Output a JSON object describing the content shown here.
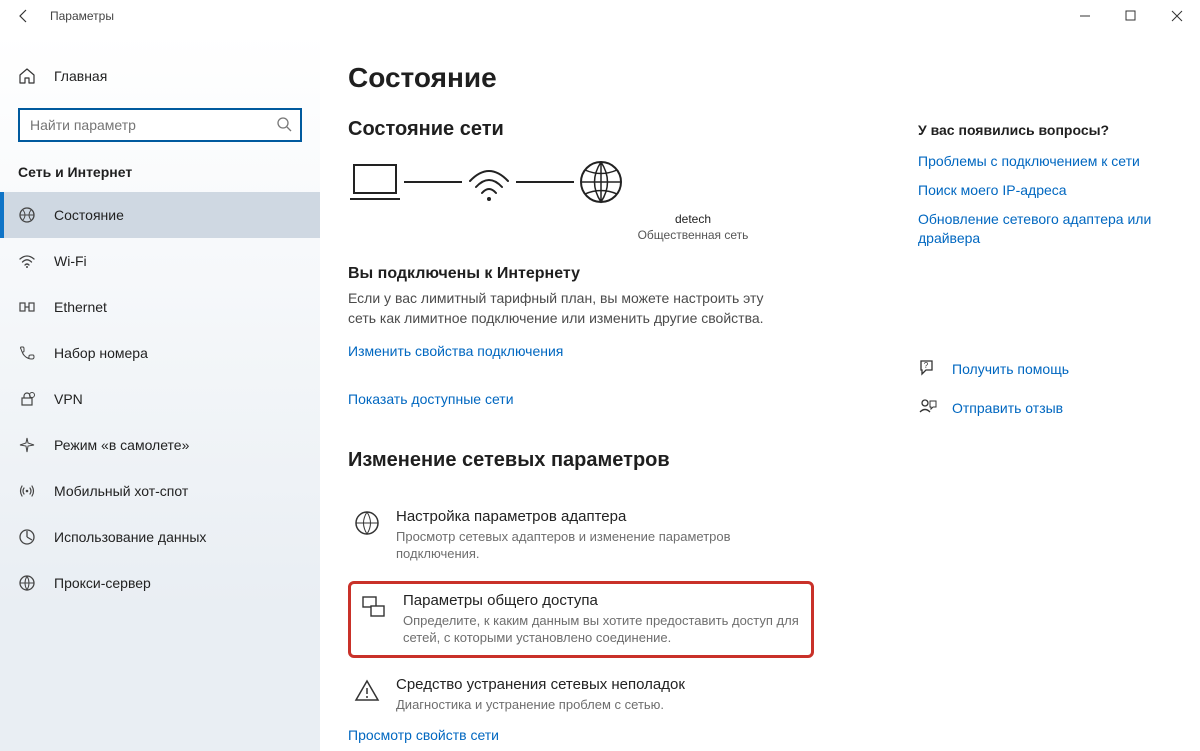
{
  "titlebar": {
    "title": "Параметры"
  },
  "sidebar": {
    "home": "Главная",
    "search_placeholder": "Найти параметр",
    "category": "Сеть и Интернет",
    "items": [
      {
        "label": "Состояние",
        "icon": "status-icon",
        "active": true
      },
      {
        "label": "Wi-Fi",
        "icon": "wifi-icon"
      },
      {
        "label": "Ethernet",
        "icon": "ethernet-icon"
      },
      {
        "label": "Набор номера",
        "icon": "dialup-icon"
      },
      {
        "label": "VPN",
        "icon": "vpn-icon"
      },
      {
        "label": "Режим «в самолете»",
        "icon": "airplane-icon"
      },
      {
        "label": "Мобильный хот-спот",
        "icon": "hotspot-icon"
      },
      {
        "label": "Использование данных",
        "icon": "datausage-icon"
      },
      {
        "label": "Прокси-сервер",
        "icon": "proxy-icon"
      }
    ]
  },
  "main": {
    "title": "Состояние",
    "status_heading": "Состояние сети",
    "diagram_name": "detech",
    "diagram_type": "Общественная сеть",
    "connected_heading": "Вы подключены к Интернету",
    "connected_desc": "Если у вас лимитный тарифный план, вы можете настроить эту сеть как лимитное подключение или изменить другие свойства.",
    "link_change_props": "Изменить свойства подключения",
    "link_available_nets": "Показать доступные сети",
    "change_heading": "Изменение сетевых параметров",
    "settings": [
      {
        "title": "Настройка параметров адаптера",
        "desc": "Просмотр сетевых адаптеров и изменение параметров подключения."
      },
      {
        "title": "Параметры общего доступа",
        "desc": "Определите, к каким данным вы хотите предоставить доступ для сетей, с которыми установлено соединение."
      },
      {
        "title": "Средство устранения сетевых неполадок",
        "desc": "Диагностика и устранение проблем с сетью."
      }
    ],
    "link_network_props": "Просмотр свойств сети"
  },
  "right": {
    "questions_heading": "У вас появились вопросы?",
    "links": [
      "Проблемы с подключением к сети",
      "Поиск моего IP-адреса",
      "Обновление сетевого адаптера или драйвера"
    ],
    "help": "Получить помощь",
    "feedback": "Отправить отзыв"
  }
}
